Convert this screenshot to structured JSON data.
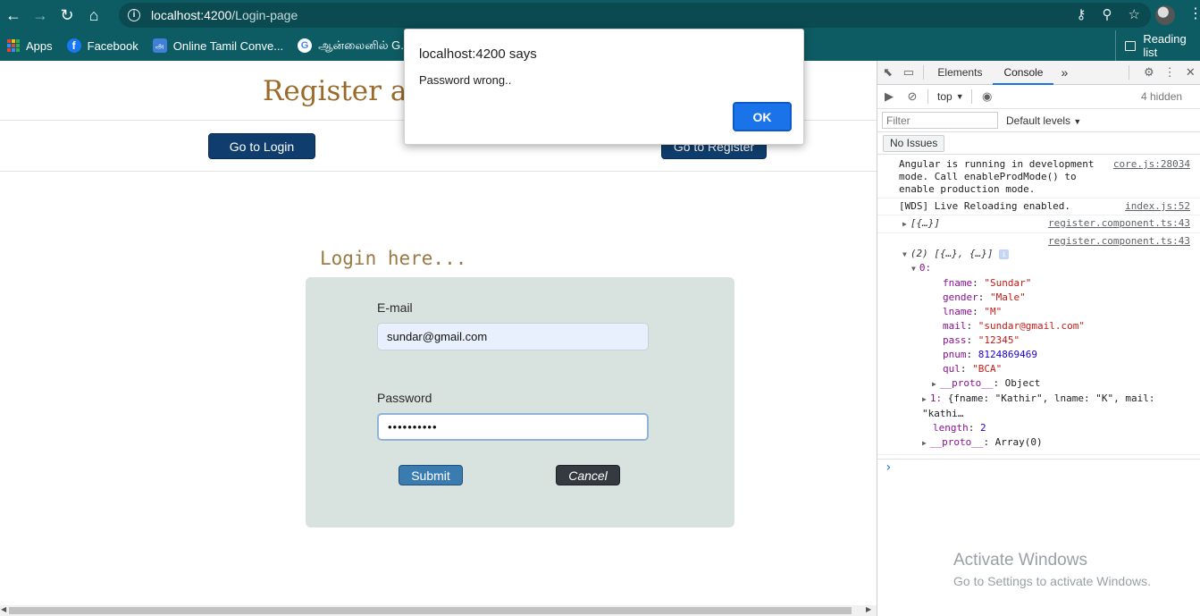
{
  "browser": {
    "url_host": "localhost:4200",
    "url_path": "/Login-page",
    "bookmarks": [
      {
        "label": "Apps"
      },
      {
        "label": "Facebook"
      },
      {
        "label": "Online Tamil Conve..."
      },
      {
        "label": "ஆன்லைனில் G..."
      }
    ],
    "reading_list": "Reading list"
  },
  "page": {
    "title": "Register and",
    "go_to_login": "Go to Login",
    "go_to_register": "Go to Register",
    "login_heading": "Login here...",
    "email_label": "E-mail",
    "email_value": "sundar@gmail.com",
    "password_label": "Password",
    "password_mask": "••••••••••",
    "submit": "Submit",
    "cancel": "Cancel"
  },
  "alert": {
    "title": "localhost:4200 says",
    "message": "Password wrong..",
    "ok": "OK"
  },
  "devtools": {
    "tabs": [
      "Elements",
      "Console"
    ],
    "more": "»",
    "context": "top",
    "hidden": "4 hidden",
    "filter_placeholder": "Filter",
    "levels": "Default levels",
    "issues": "No Issues",
    "logs": {
      "angular_msg": "Angular is running in development mode. Call enableProdMode() to enable production mode.",
      "angular_src": "core.js:28034",
      "wds_msg": "[WDS] Live Reloading enabled.",
      "wds_src": "index.js:52",
      "obj1_preview": "[{…}]",
      "obj1_src": "register.component.ts:43",
      "obj2_src": "register.component.ts:43",
      "obj2_preview": "(2) [{…}, {…}]",
      "item0_key": "0:",
      "fields": [
        {
          "key": "fname",
          "value": "\"Sundar\"",
          "type": "s"
        },
        {
          "key": "gender",
          "value": "\"Male\"",
          "type": "s"
        },
        {
          "key": "lname",
          "value": "\"M\"",
          "type": "s"
        },
        {
          "key": "mail",
          "value": "\"sundar@gmail.com\"",
          "type": "s"
        },
        {
          "key": "pass",
          "value": "\"12345\"",
          "type": "s"
        },
        {
          "key": "pnum",
          "value": "8124869469",
          "type": "n"
        },
        {
          "key": "qul",
          "value": "\"BCA\"",
          "type": "s"
        }
      ],
      "proto_obj": "__proto__",
      "proto_obj_val": ": Object",
      "item1_key": "1:",
      "item1_preview": "{fname: \"Kathir\", lname: \"K\", mail: \"kathi…",
      "length_key": "length",
      "length_val": "2",
      "proto_arr": "__proto__",
      "proto_arr_val": ": Array(0)"
    },
    "prompt": "›"
  },
  "watermark": {
    "line1": "Activate Windows",
    "line2": "Go to Settings to activate Windows."
  },
  "colors": {
    "chrome_bar": "#0d5c63",
    "nav_button": "#0f3e6e",
    "card_bg": "#d8e3df",
    "submit": "#3a7bb0",
    "cancel": "#343a40",
    "ok_button": "#1a73e8",
    "title": "#9a6a2a"
  }
}
